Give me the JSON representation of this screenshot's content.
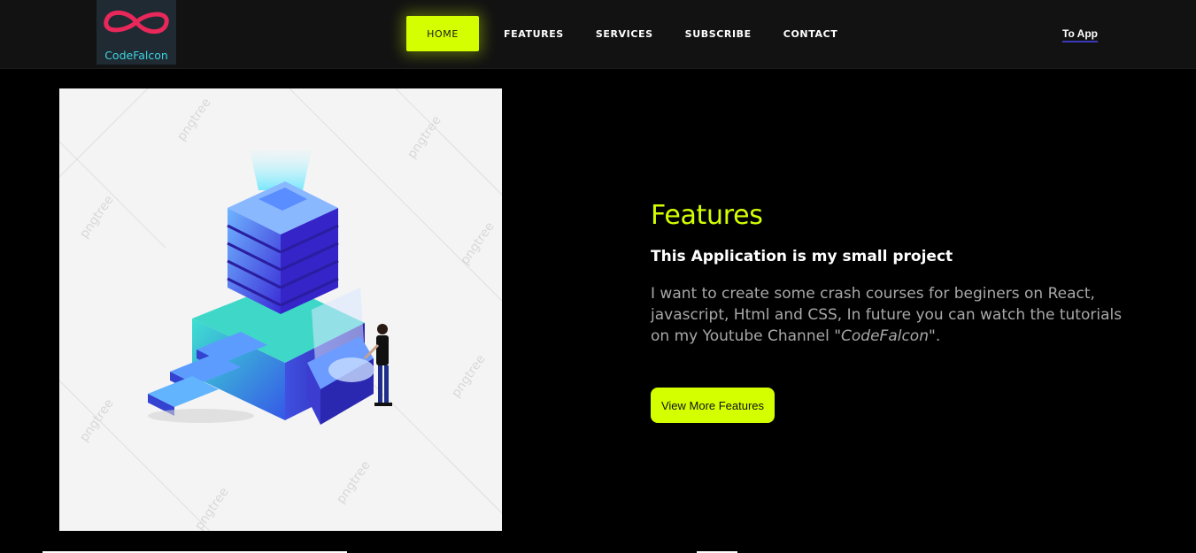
{
  "brand": {
    "name": "CodeFalcon"
  },
  "nav": {
    "items": [
      {
        "label": "HOME",
        "active": true
      },
      {
        "label": "FEATURES",
        "active": false
      },
      {
        "label": "SERVICES",
        "active": false
      },
      {
        "label": "SUBSCRIBE",
        "active": false
      },
      {
        "label": "CONTACT",
        "active": false
      }
    ],
    "to_app": "To App"
  },
  "hero": {
    "image_watermark": "pngtree"
  },
  "features": {
    "title": "Features",
    "subtitle": "This Application is my small project",
    "description": "I want to create some crash courses for beginers on React, javascript, Html and CSS, In future you can watch the tutorials on my Youtube Channel",
    "channel": "\"CodeFalcon\"",
    "period": ".",
    "button": "View More Features"
  },
  "colors": {
    "accent": "#d4ff00",
    "background": "#000000",
    "navbar": "#121212",
    "logo_infinity": "#e8285a",
    "logo_text": "#3fd2df"
  }
}
